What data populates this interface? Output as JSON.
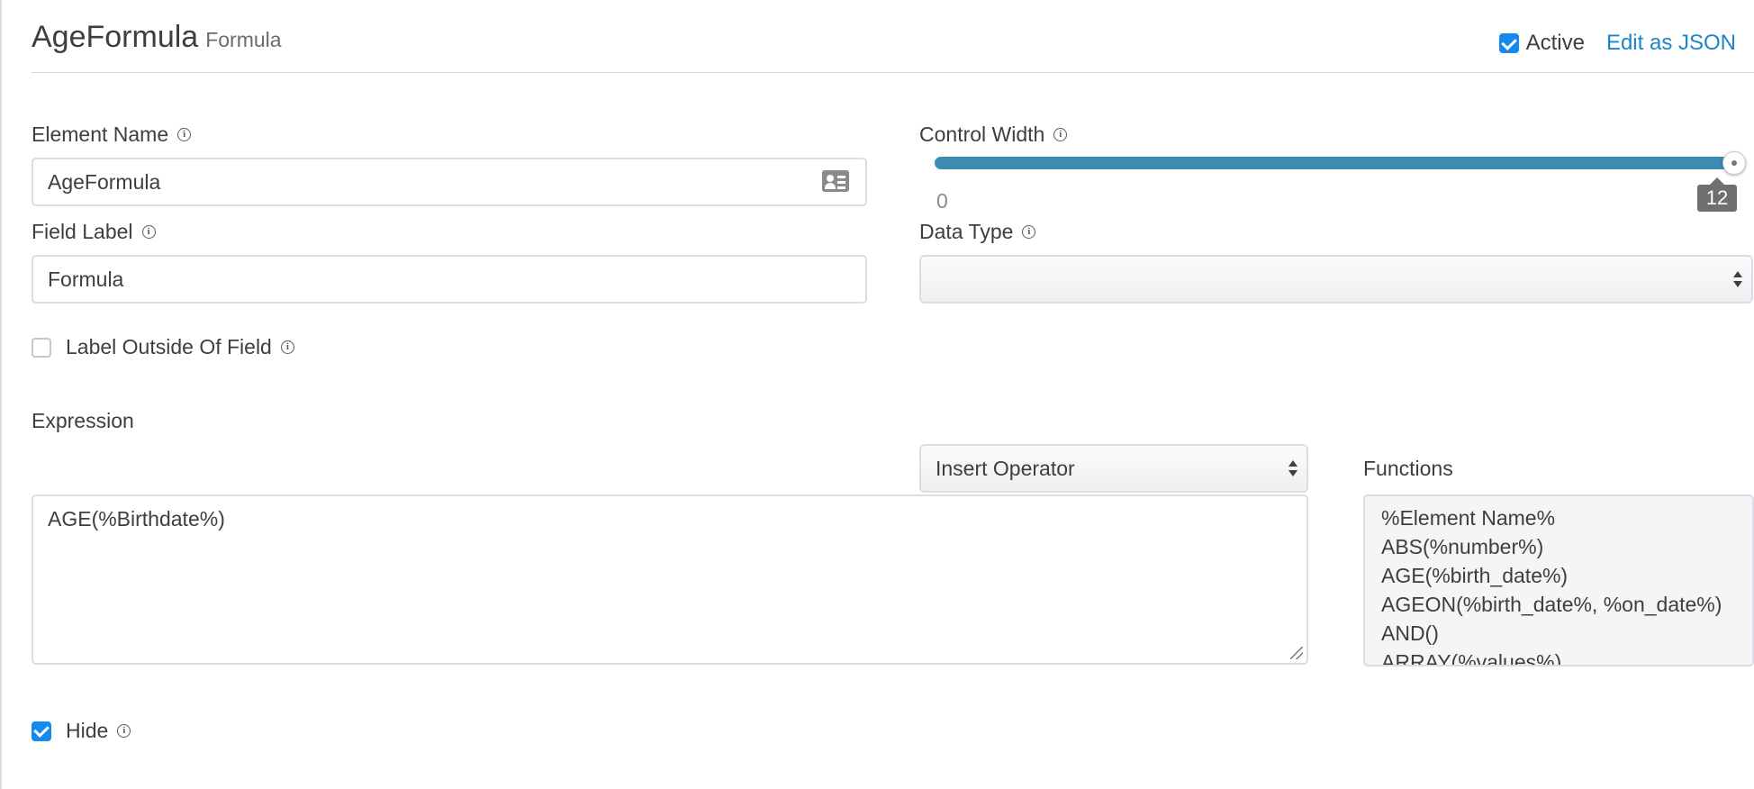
{
  "header": {
    "title": "AgeFormula",
    "subtitle": "Formula",
    "active_label": "Active",
    "active_checked": true,
    "edit_json_label": "Edit as JSON"
  },
  "element_name": {
    "label": "Element Name",
    "value": "AgeFormula",
    "icon": "contact-card-icon"
  },
  "control_width": {
    "label": "Control Width",
    "min_label": "0",
    "value_label": "12",
    "value": 12,
    "max": 12
  },
  "field_label": {
    "label": "Field Label",
    "value": "Formula"
  },
  "data_type": {
    "label": "Data Type",
    "value": ""
  },
  "label_outside": {
    "label": "Label Outside Of Field",
    "checked": false
  },
  "expression": {
    "label": "Expression",
    "value": "AGE(%Birthdate%)",
    "insert_operator_label": "Insert Operator"
  },
  "functions": {
    "label": "Functions",
    "items": [
      "%Element Name%",
      "ABS(%number%)",
      "AGE(%birth_date%)",
      "AGEON(%birth_date%, %on_date%)",
      "AND()",
      "ARRAY(%values%)"
    ]
  },
  "hide": {
    "label": "Hide",
    "checked": true
  },
  "colors": {
    "accent": "#1589ee",
    "link": "#1d86c8",
    "slider": "#3b8bb3"
  }
}
